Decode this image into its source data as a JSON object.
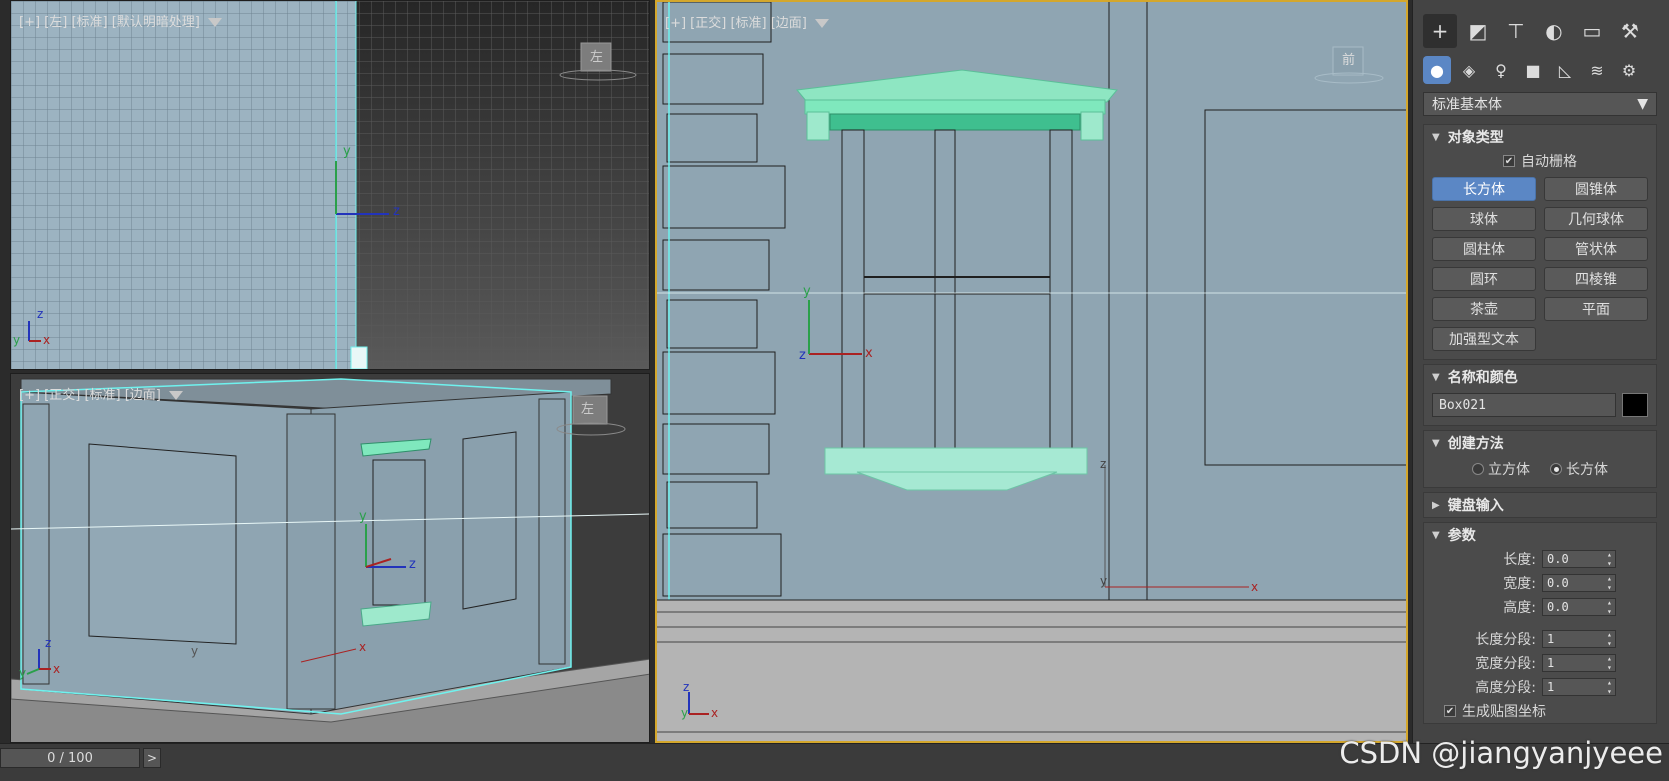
{
  "viewports": {
    "top_left_label": "[+] [左] [标准] [默认明暗处理]",
    "persp_label": "[+] [正交] [标准] [边面]",
    "front_label": "[+] [正交] [标准] [边面]",
    "viewcube_left": "左",
    "viewcube_persp": "左",
    "viewcube_front": "前",
    "axis_x": "x",
    "axis_y": "y",
    "axis_z": "z"
  },
  "command_panel": {
    "tabs": [
      "create-tab",
      "modify-tab",
      "hierarchy-tab",
      "motion-tab",
      "display-tab",
      "utilities-tab"
    ],
    "subtabs": [
      "geometry",
      "shapes",
      "lights",
      "cameras",
      "helpers",
      "spacewarps",
      "systems"
    ],
    "category_dropdown": "标准基本体",
    "object_type": {
      "header": "对象类型",
      "autogrid_label": "自动栅格",
      "buttons": [
        "长方体",
        "圆锥体",
        "球体",
        "几何球体",
        "圆柱体",
        "管状体",
        "圆环",
        "四棱锥",
        "茶壶",
        "平面",
        "加强型文本"
      ]
    },
    "name_color": {
      "header": "名称和颜色",
      "name_value": "Box021",
      "color": "#000000"
    },
    "creation_method": {
      "header": "创建方法",
      "option_cube": "立方体",
      "option_box": "长方体"
    },
    "keyboard_entry": {
      "header": "键盘输入"
    },
    "parameters": {
      "header": "参数",
      "length_label": "长度:",
      "length_value": "0.0",
      "width_label": "宽度:",
      "width_value": "0.0",
      "height_label": "高度:",
      "height_value": "0.0",
      "length_segs_label": "长度分段:",
      "length_segs_value": "1",
      "width_segs_label": "宽度分段:",
      "width_segs_value": "1",
      "height_segs_label": "高度分段:",
      "height_segs_value": "1",
      "gen_map_label": "生成贴图坐标"
    }
  },
  "timeline": {
    "frame_display": "0 / 100",
    "next_symbol": ">"
  },
  "watermark": "CSDN @jiangyanjyeee",
  "colors": {
    "selection_cyan": "#6ff2ee",
    "active_blue": "#5b87c5",
    "window_green": "#7fe8bd",
    "model_fill": "#8fa5b2",
    "viewport_frame": "#d4a72c"
  }
}
